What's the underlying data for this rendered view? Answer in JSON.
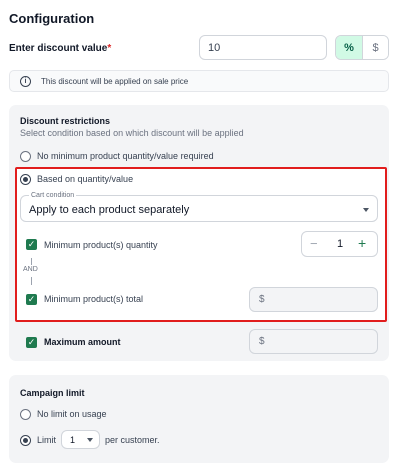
{
  "header": {
    "title": "Configuration"
  },
  "discount": {
    "label": "Enter discount value",
    "required_mark": "*",
    "value": "10",
    "percent_symbol": "%",
    "dollar_symbol": "$",
    "info_text": "This discount will be applied on sale price",
    "info_icon": "i"
  },
  "restrictions": {
    "title": "Discount restrictions",
    "subtitle": "Select condition based on which discount will be applied",
    "option_none": "No minimum product quantity/value required",
    "option_based": "Based on quantity/value",
    "cart_condition_label": "Cart condition",
    "cart_condition_value": "Apply to each product separately",
    "min_qty_label": "Minimum product(s) quantity",
    "min_qty_value": "1",
    "minus": "−",
    "plus": "+",
    "and_label": "AND",
    "min_total_label": "Minimum product(s) total",
    "min_total_prefix": "$",
    "max_amount_label": "Maximum amount",
    "max_amount_prefix": "$",
    "check_mark": "✓"
  },
  "campaign": {
    "title": "Campaign limit",
    "option_no_limit": "No limit on usage",
    "option_limit": "Limit",
    "limit_value": "1",
    "per_customer": "per customer."
  },
  "colors": {
    "accent_green": "#1f7a4f",
    "highlight_red": "#e11d1d"
  }
}
